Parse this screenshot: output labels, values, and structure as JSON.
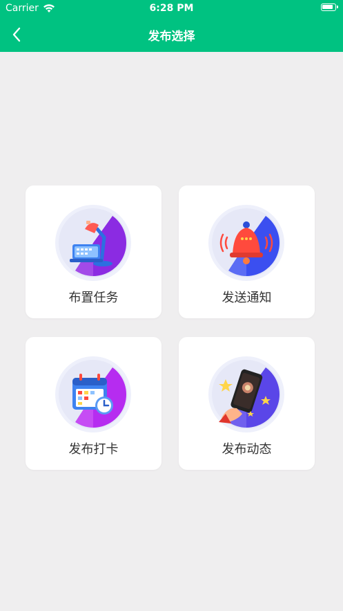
{
  "status_bar": {
    "carrier": "Carrier",
    "time": "6:28 PM"
  },
  "nav": {
    "title": "发布选择",
    "back_icon": "chevron-left-icon"
  },
  "options": [
    {
      "label": "布置任务",
      "icon": "desk-lamp-task-icon"
    },
    {
      "label": "发送通知",
      "icon": "bell-notification-icon"
    },
    {
      "label": "发布打卡",
      "icon": "calendar-clock-icon"
    },
    {
      "label": "发布动态",
      "icon": "phone-post-icon"
    }
  ],
  "colors": {
    "header_bg": "#00c281",
    "page_bg": "#efeeef",
    "card_bg": "#ffffff",
    "label_text": "#333333",
    "purple_accent": "#8b2be2",
    "blue_accent": "#3b4ff0",
    "magenta_accent": "#b62cf0",
    "indigo_accent": "#5a46e8"
  }
}
